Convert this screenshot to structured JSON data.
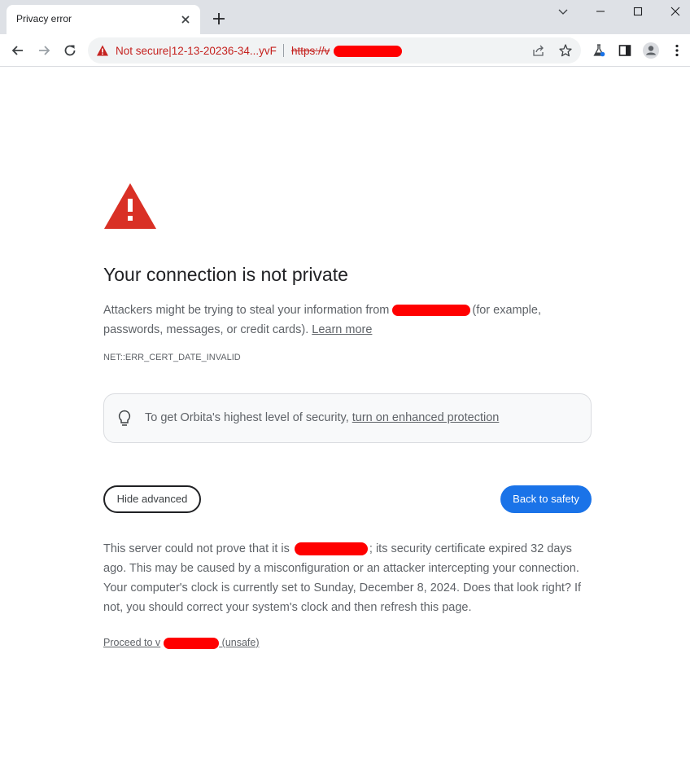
{
  "tab": {
    "title": "Privacy error"
  },
  "omnibox": {
    "security_label": "Not secure",
    "separator": "|",
    "site_name": "12-13-20236-34...yvF",
    "url_prefix": "https://v"
  },
  "page": {
    "heading": "Your connection is not private",
    "intro_before": "Attackers might be trying to steal your information from",
    "intro_after": "(for example, passwords, messages, or credit cards).",
    "learn_more": "Learn more",
    "error_code": "NET::ERR_CERT_DATE_INVALID",
    "enhanced_text": "To get Orbita's highest level of security,",
    "enhanced_link": "turn on enhanced protection",
    "hide_advanced": "Hide advanced",
    "back_to_safety": "Back to safety",
    "details_before": "This server could not prove that it is",
    "details_after": "; its security certificate expired 32 days ago. This may be caused by a misconfiguration or an attacker intercepting your connection. Your computer's clock is currently set to Sunday, December 8, 2024. Does that look right? If not, you should correct your system's clock and then refresh this page.",
    "proceed_prefix": "Proceed to v",
    "proceed_suffix": " (unsafe)"
  },
  "colors": {
    "warning_red": "#d93025",
    "primary_blue": "#1a73e8",
    "redaction": "#ff0000"
  }
}
